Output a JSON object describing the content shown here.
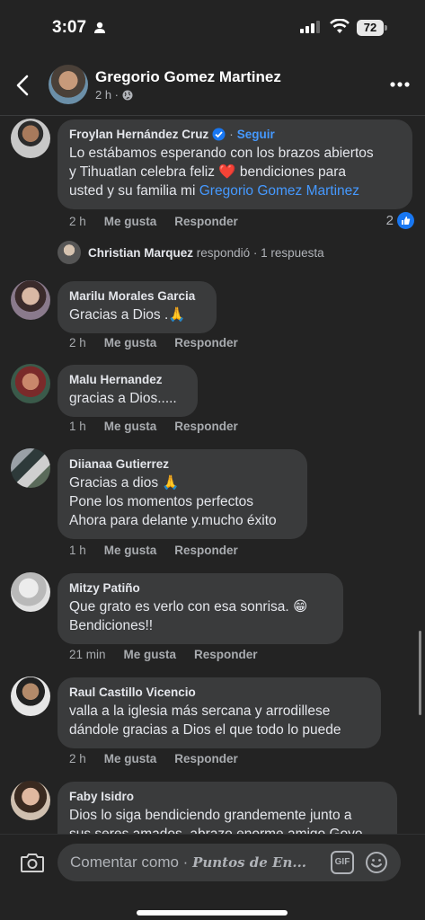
{
  "status": {
    "time": "3:07",
    "battery": "72"
  },
  "header": {
    "name": "Gregorio Gomez Martinez",
    "time": "2 h ·"
  },
  "comments": [
    {
      "name": "Froylan Hernández Cruz",
      "follow": "Seguir",
      "text1": "Lo estábamos esperando con los brazos abiertos",
      "text2a": "y Tihuatlan celebra feliz",
      "text2b": "bendiciones para",
      "text3a": "usted y su familia mi",
      "mention": "Gregorio Gomez Martinez",
      "time": "2 h",
      "like": "Me gusta",
      "reply": "Responder",
      "reaction_count": "2"
    },
    {
      "name": "Marilu Morales Garcia",
      "text1": "Gracias a Dios .🙏",
      "time": "2 h",
      "like": "Me gusta",
      "reply": "Responder"
    },
    {
      "name": "Malu Hernandez",
      "text1": "gracias a Dios.....",
      "time": "1 h",
      "like": "Me gusta",
      "reply": "Responder"
    },
    {
      "name": "Diianaa Gutierrez",
      "text1": "Gracias a dios 🙏",
      "text2": "Pone los momentos perfectos",
      "text3": "Ahora para delante y.mucho éxito",
      "time": "1 h",
      "like": "Me gusta",
      "reply": "Responder"
    },
    {
      "name": "Mitzy Patiño",
      "text1": "Que grato es verlo con esa sonrisa. 😁",
      "text2": "Bendiciones!!",
      "time": "21 min",
      "like": "Me gusta",
      "reply": "Responder"
    },
    {
      "name": "Raul Castillo Vicencio",
      "text1": "valla a la iglesia más sercana y arrodillese",
      "text2": "dándole gracias  a Dios el que todo lo puede",
      "time": "2 h",
      "like": "Me gusta",
      "reply": "Responder"
    },
    {
      "name": "Faby Isidro",
      "text1": "Dios lo siga bendiciendo grandemente junto a",
      "text2": "sus seres amados, abrazo enorme amigo Goyo"
    }
  ],
  "reply_row": {
    "name": "Christian Marquez",
    "verb": "respondió",
    "count": "· 1 respuesta"
  },
  "composer": {
    "placeholder": "Comentar como ·",
    "page_name": "Puntos de En...",
    "gif": "GIF"
  },
  "colors": {
    "background": "#232323",
    "bubble": "#3a3b3c",
    "link": "#4599ff",
    "like_blue": "#1877f2"
  }
}
